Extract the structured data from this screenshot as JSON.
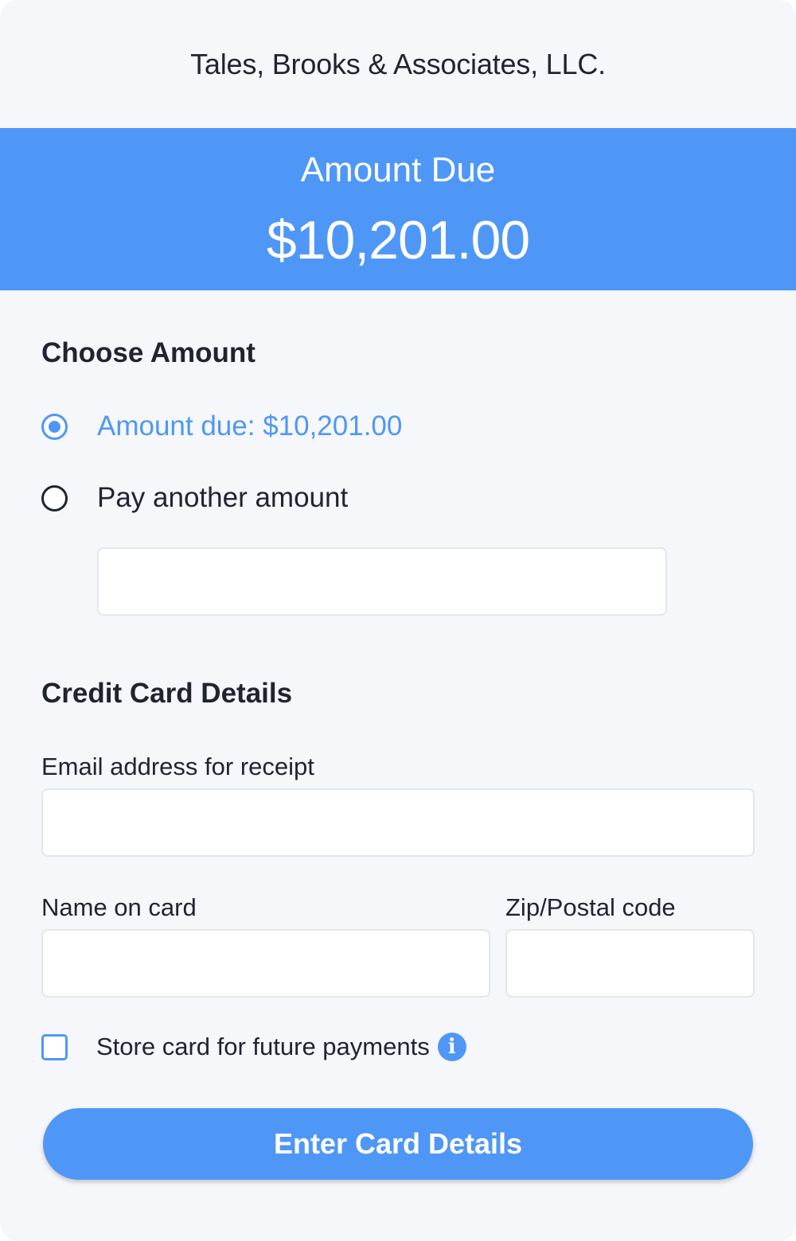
{
  "header": {
    "firm_name": "Tales, Brooks & Associates, LLC."
  },
  "banner": {
    "label": "Amount Due",
    "amount": "$10,201.00"
  },
  "choose_amount": {
    "title": "Choose Amount",
    "options": [
      {
        "label": "Amount due: $10,201.00",
        "selected": true
      },
      {
        "label": "Pay another amount",
        "selected": false
      }
    ],
    "other_amount_value": ""
  },
  "card_details": {
    "title": "Credit Card Details",
    "email_label": "Email address for receipt",
    "email_value": "",
    "name_label": "Name on card",
    "name_value": "",
    "zip_label": "Zip/Postal code",
    "zip_value": "",
    "store_card_label": "Store card for future payments",
    "store_card_checked": false
  },
  "submit": {
    "label": "Enter Card Details"
  },
  "icons": {
    "info": "info-icon"
  },
  "colors": {
    "accent": "#4f97f7",
    "background": "#f5f7fa",
    "text": "#1f2430"
  }
}
